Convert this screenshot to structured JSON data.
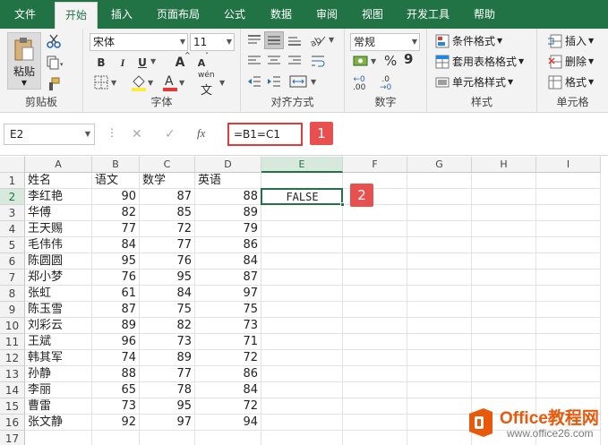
{
  "ribbon": {
    "tabs": [
      "文件",
      "开始",
      "插入",
      "页面布局",
      "公式",
      "数据",
      "审阅",
      "视图",
      "开发工具",
      "帮助"
    ],
    "active_tab": "开始",
    "clipboard": {
      "paste_label": "粘贴",
      "group_label": "剪贴板"
    },
    "font": {
      "name": "宋体",
      "size": "11",
      "bold": "B",
      "italic": "I",
      "underline": "U",
      "grow": "A",
      "shrink": "A",
      "wen": "wén",
      "group_label": "字体"
    },
    "alignment": {
      "group_label": "对齐方式"
    },
    "number": {
      "format": "常规",
      "percent": "%",
      "comma": "9",
      "dec_inc": ".00",
      "dec_dec": ".0",
      "group_label": "数字"
    },
    "styles": {
      "conditional": "条件格式",
      "table": "套用表格格式",
      "cell_styles": "单元格样式",
      "group_label": "样式"
    },
    "cells": {
      "insert": "插入",
      "delete": "删除",
      "format": "格式",
      "group_label": "单元格"
    }
  },
  "formula_bar": {
    "name_box": "E2",
    "cancel": "✕",
    "enter": "✓",
    "fx": "fx",
    "formula": "=B1=C1"
  },
  "callouts": [
    "1",
    "2"
  ],
  "sheet": {
    "columns": [
      "A",
      "B",
      "C",
      "D",
      "E",
      "F",
      "G",
      "H",
      "I"
    ],
    "rows": [
      [
        "1",
        "姓名",
        "语文",
        "数学",
        "英语"
      ],
      [
        "2",
        "李红艳",
        "90",
        "87",
        "88"
      ],
      [
        "3",
        "华傅",
        "82",
        "85",
        "89"
      ],
      [
        "4",
        "王天赐",
        "77",
        "72",
        "79"
      ],
      [
        "5",
        "毛伟伟",
        "84",
        "77",
        "86"
      ],
      [
        "6",
        "陈圆圆",
        "95",
        "76",
        "84"
      ],
      [
        "7",
        "郑小梦",
        "76",
        "95",
        "87"
      ],
      [
        "8",
        "张虹",
        "61",
        "84",
        "97"
      ],
      [
        "9",
        "陈玉雪",
        "87",
        "75",
        "75"
      ],
      [
        "10",
        "刘彩云",
        "89",
        "82",
        "73"
      ],
      [
        "11",
        "王斌",
        "96",
        "73",
        "71"
      ],
      [
        "12",
        "韩其军",
        "74",
        "89",
        "72"
      ],
      [
        "13",
        "孙静",
        "88",
        "77",
        "86"
      ],
      [
        "14",
        "李丽",
        "65",
        "78",
        "84"
      ],
      [
        "15",
        "曹雷",
        "73",
        "95",
        "72"
      ],
      [
        "16",
        "张文静",
        "92",
        "97",
        "94"
      ],
      [
        "17",
        "",
        "",
        "",
        ""
      ]
    ],
    "e2_value": "FALSE"
  },
  "logo": {
    "brand": "Office教程网",
    "site": "www.office26.com"
  },
  "colors": {
    "accent": "#217346",
    "callout": "#e85050",
    "logo_orange": "#e8590c"
  }
}
